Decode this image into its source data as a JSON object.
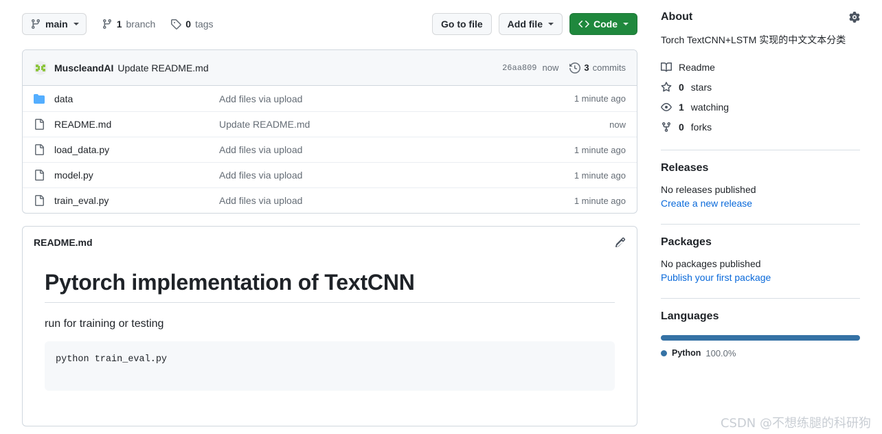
{
  "toolbar": {
    "branch_label": "main",
    "branches": "1 branch",
    "branches_count": "1",
    "branches_word": "branch",
    "tags": "0 tags",
    "tags_count": "0",
    "tags_word": "tags",
    "go_to_file": "Go to file",
    "add_file": "Add file",
    "code": "Code"
  },
  "commit": {
    "author": "MuscleandAI",
    "message": "Update README.md",
    "hash": "26aa809",
    "time": "now",
    "commits_count": "3",
    "commits_word": "commits"
  },
  "files": [
    {
      "icon": "folder-icon",
      "type": "folder",
      "name": "data",
      "message": "Add files via upload",
      "time": "1 minute ago"
    },
    {
      "icon": "file-icon",
      "type": "file",
      "name": "README.md",
      "message": "Update README.md",
      "time": "now"
    },
    {
      "icon": "file-icon",
      "type": "file",
      "name": "load_data.py",
      "message": "Add files via upload",
      "time": "1 minute ago"
    },
    {
      "icon": "file-icon",
      "type": "file",
      "name": "model.py",
      "message": "Add files via upload",
      "time": "1 minute ago"
    },
    {
      "icon": "file-icon",
      "type": "file",
      "name": "train_eval.py",
      "message": "Add files via upload",
      "time": "1 minute ago"
    }
  ],
  "readme": {
    "title": "README.md",
    "heading": "Pytorch implementation of TextCNN",
    "paragraph": "run for training or testing",
    "code": "python train_eval.py"
  },
  "about": {
    "title": "About",
    "description": "Torch TextCNN+LSTM 实现的中文文本分类",
    "items": [
      {
        "icon": "book-icon",
        "label": "Readme",
        "count": ""
      },
      {
        "icon": "star-icon",
        "label": "stars",
        "count": "0"
      },
      {
        "icon": "eye-icon",
        "label": "watching",
        "count": "1"
      },
      {
        "icon": "fork-icon",
        "label": "forks",
        "count": "0"
      }
    ]
  },
  "releases": {
    "title": "Releases",
    "empty": "No releases published",
    "link": "Create a new release"
  },
  "packages": {
    "title": "Packages",
    "empty": "No packages published",
    "link": "Publish your first package"
  },
  "languages": {
    "title": "Languages",
    "entries": [
      {
        "name": "Python",
        "percent": "100.0%",
        "color": "#3572a5"
      }
    ]
  },
  "watermark": "CSDN @不想练腿的科研狗",
  "colors": {
    "accent_green": "#1f883d",
    "link_blue": "#0969da",
    "folder_blue": "#54aeff",
    "python_blue": "#3572a5",
    "border": "#d0d7de"
  }
}
